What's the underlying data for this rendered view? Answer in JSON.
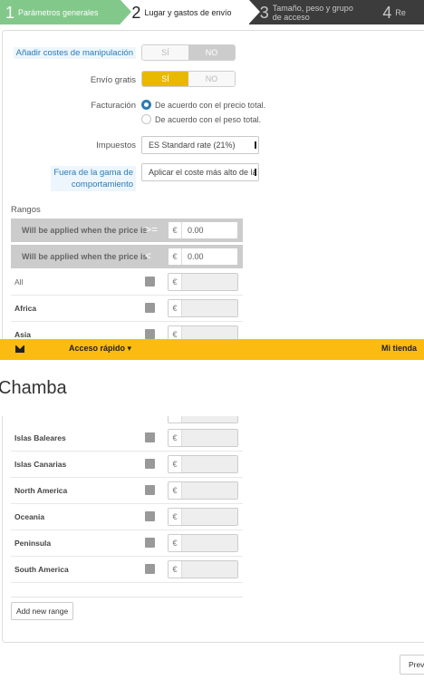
{
  "wizard": {
    "steps": [
      {
        "num": "1",
        "label": "Parámetros generales"
      },
      {
        "num": "2",
        "label": "Lugar y gastos de envío"
      },
      {
        "num": "3",
        "label": "Tamaño, peso y grupo de acceso"
      },
      {
        "num": "4",
        "label": "Re"
      }
    ]
  },
  "form": {
    "handling_label": "Añadir costes de manipulación",
    "handling_yes": "SÍ",
    "handling_no": "NO",
    "free_label": "Envío gratis",
    "free_yes": "SÍ",
    "free_no": "NO",
    "billing_label": "Facturación",
    "billing_option_price": "De acuerdo con el precio total.",
    "billing_option_weight": "De acuerdo con el peso total.",
    "tax_label": "Impuestos",
    "tax_value": "ES Standard rate (21%)",
    "outofrange_label_1": "Fuera de la gama de",
    "outofrange_label_2": "comportamiento",
    "outofrange_value": "Aplicar el coste más alto de la ga"
  },
  "ranges": {
    "title": "Rangos",
    "rows": [
      {
        "text": "Will be applied when the price is",
        "operator": ">=",
        "currency": "€",
        "value": "0.00"
      },
      {
        "text": "Will be applied when the price is",
        "operator": "<",
        "currency": "€",
        "value": "0.00"
      }
    ]
  },
  "zones_top": [
    {
      "name": "All",
      "currency": "€"
    },
    {
      "name": "Africa",
      "currency": "€"
    },
    {
      "name": "Asia",
      "currency": "€"
    }
  ],
  "quickbar": {
    "access": "Acceso rápido ▾",
    "shop": "Mi tienda"
  },
  "shop_title": "Chamba",
  "zones_bottom": [
    {
      "name": "Islas Baleares",
      "currency": "€"
    },
    {
      "name": "Islas Canarias",
      "currency": "€"
    },
    {
      "name": "North America",
      "currency": "€"
    },
    {
      "name": "Oceania",
      "currency": "€"
    },
    {
      "name": "Peninsula",
      "currency": "€"
    },
    {
      "name": "South America",
      "currency": "€"
    }
  ],
  "buttons": {
    "add_range": "Add new range",
    "previous": "Previo"
  },
  "colors": {
    "done_step": "#82c88a",
    "todo_step": "#3c3c3c",
    "accent_yellow": "#fbbb10",
    "link_blue": "#2c7bb5"
  }
}
